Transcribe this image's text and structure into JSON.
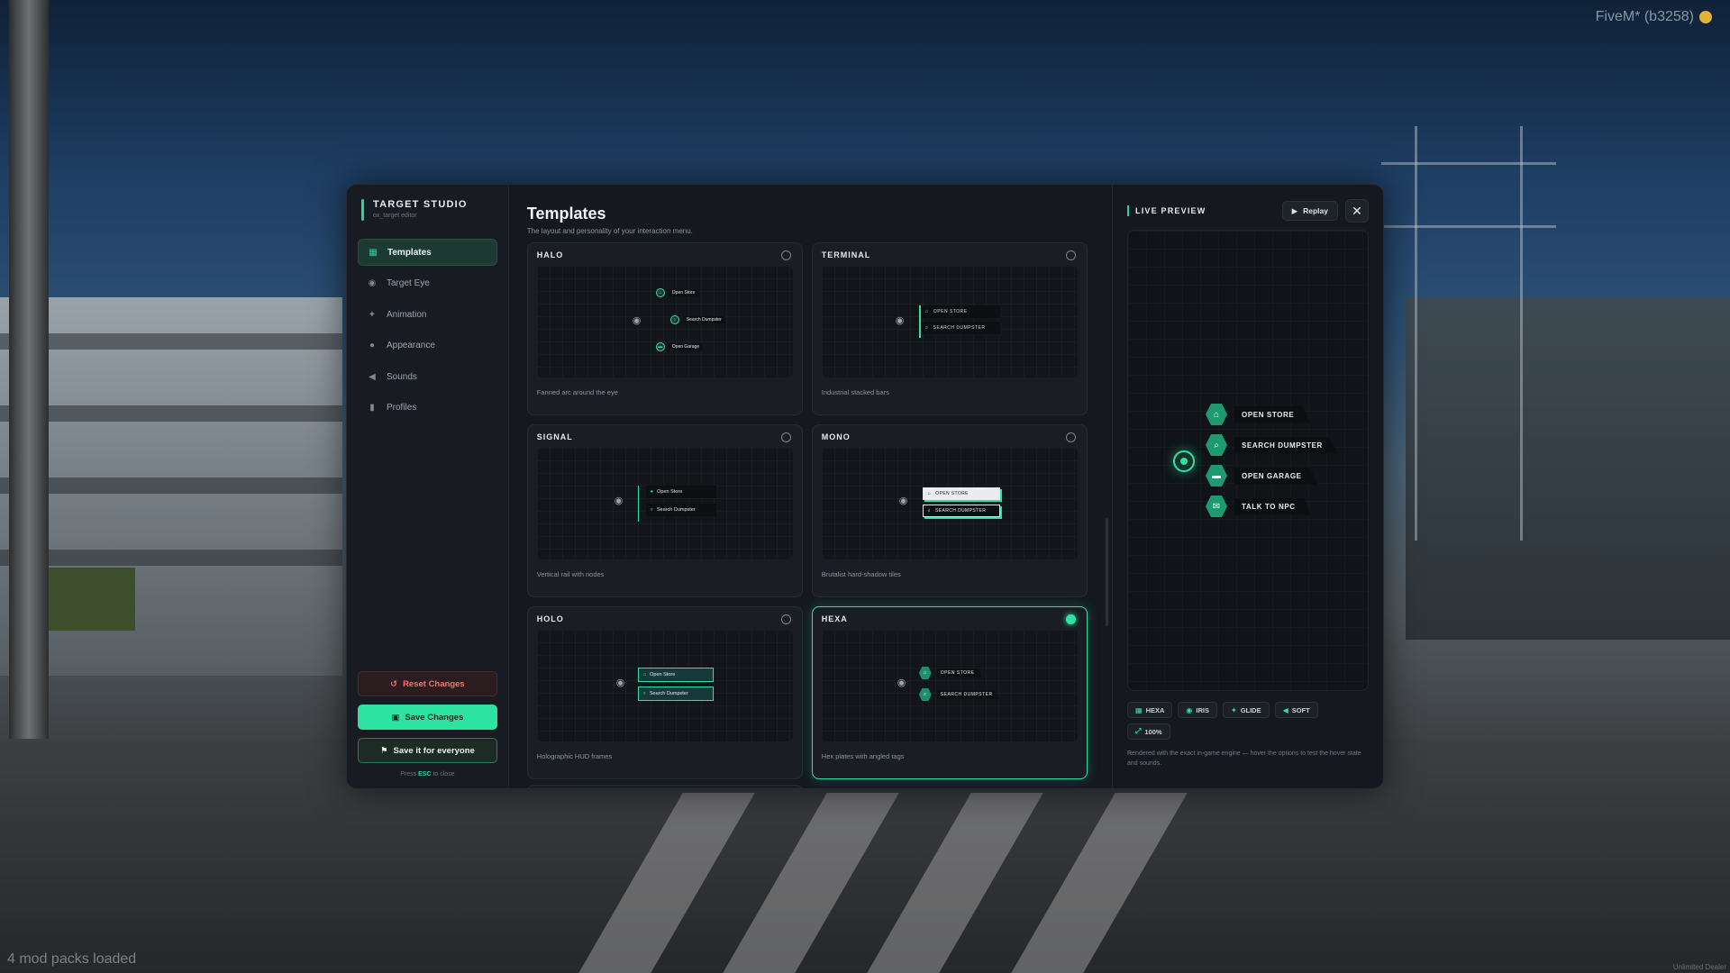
{
  "overlay": {
    "fivem_label": "FiveM* (b3258)",
    "modpacks": "4 mod packs loaded",
    "watermark": "Unlimited Dealer"
  },
  "sidebar": {
    "title": "TARGET STUDIO",
    "subtitle": "ox_target editor",
    "items": [
      {
        "label": "Templates",
        "icon": "grid-icon"
      },
      {
        "label": "Target Eye",
        "icon": "eye-icon"
      },
      {
        "label": "Animation",
        "icon": "sparkle-icon"
      },
      {
        "label": "Appearance",
        "icon": "palette-icon"
      },
      {
        "label": "Sounds",
        "icon": "speaker-icon"
      },
      {
        "label": "Profiles",
        "icon": "bookmark-icon"
      }
    ],
    "reset_label": "Reset Changes",
    "save_label": "Save Changes",
    "everyone_label": "Save it for everyone",
    "esc_prefix": "Press",
    "esc_key": "ESC",
    "esc_suffix": "to close"
  },
  "main": {
    "title": "Templates",
    "subtitle": "The layout and personality of your interaction menu.",
    "cards": [
      {
        "name": "HALO",
        "desc": "Fanned arc around the eye",
        "selected": false,
        "items": [
          "Open Store",
          "Search Dumpster",
          "Open Garage"
        ]
      },
      {
        "name": "TERMINAL",
        "desc": "Industrial stacked bars",
        "selected": false,
        "items": [
          "OPEN STORE",
          "SEARCH DUMPSTER"
        ]
      },
      {
        "name": "SIGNAL",
        "desc": "Vertical rail with nodes",
        "selected": false,
        "items": [
          "Open Store",
          "Search Dumpster"
        ]
      },
      {
        "name": "MONO",
        "desc": "Brutalist hard-shadow tiles",
        "selected": false,
        "items": [
          "OPEN STORE",
          "SEARCH DUMPSTER"
        ]
      },
      {
        "name": "HOLO",
        "desc": "Holographic HUD frames",
        "selected": false,
        "items": [
          "Open Store",
          "Search Dumpster"
        ]
      },
      {
        "name": "HEXA",
        "desc": "Hex plates with angled tags",
        "selected": true,
        "items": [
          "OPEN STORE",
          "SEARCH DUMPSTER"
        ]
      }
    ]
  },
  "preview": {
    "title": "LIVE PREVIEW",
    "replay_label": "Replay",
    "options": [
      {
        "label": "OPEN STORE",
        "icon": "store-icon"
      },
      {
        "label": "SEARCH DUMPSTER",
        "icon": "search-icon"
      },
      {
        "label": "OPEN GARAGE",
        "icon": "car-icon"
      },
      {
        "label": "TALK TO NPC",
        "icon": "chat-icon"
      }
    ],
    "chips": [
      {
        "label": "HEXA",
        "icon": "grid-icon"
      },
      {
        "label": "IRIS",
        "icon": "eye-icon"
      },
      {
        "label": "GLIDE",
        "icon": "sparkle-icon"
      },
      {
        "label": "SOFT",
        "icon": "speaker-icon"
      },
      {
        "label": "100%",
        "icon": "resize-icon"
      }
    ],
    "note": "Rendered with the exact in-game engine — hover the options to test the hover state and sounds."
  },
  "colors": {
    "accent": "#2ee3a2",
    "danger": "#ff6b6b",
    "panel_bg": "#15191f"
  }
}
